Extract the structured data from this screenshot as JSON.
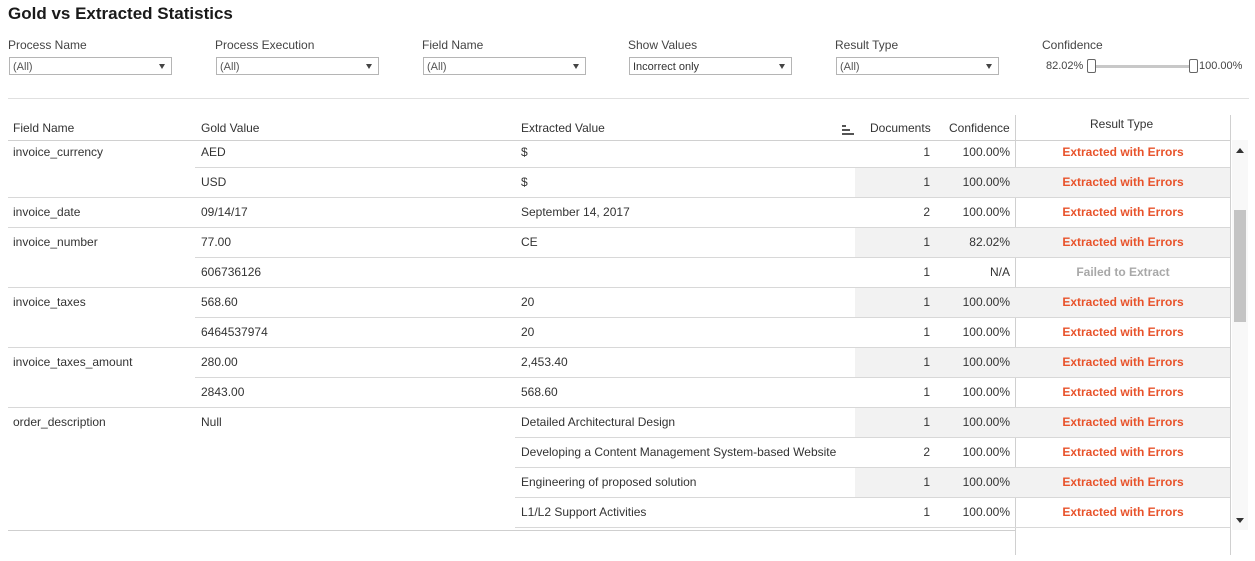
{
  "title": "Gold vs Extracted Statistics",
  "colors": {
    "error": "#e8532b",
    "failed": "#a8a8a8",
    "shade": "#f2f2f2"
  },
  "filters": [
    {
      "label": "Process Name",
      "value": "(All)"
    },
    {
      "label": "Process Execution",
      "value": "(All)"
    },
    {
      "label": "Field Name",
      "value": "(All)"
    },
    {
      "label": "Show Values",
      "value": "Incorrect only"
    },
    {
      "label": "Result Type",
      "value": "(All)"
    }
  ],
  "confidence": {
    "label": "Confidence",
    "min_label": "82.02%",
    "max_label": "100.00%",
    "range": [
      0.8202,
      1.0
    ]
  },
  "columns": {
    "field": "Field Name",
    "gold": "Gold Value",
    "extracted": "Extracted Value",
    "documents": "Documents",
    "confidence": "Confidence",
    "result": "Result Type"
  },
  "rows": [
    {
      "field": "invoice_currency",
      "gold": "AED",
      "extracted": "$",
      "documents": "1",
      "confidence": "100.00%",
      "result": "Extracted with Errors",
      "status": "error"
    },
    {
      "field": "",
      "gold": "USD",
      "extracted": "$",
      "documents": "1",
      "confidence": "100.00%",
      "result": "Extracted with Errors",
      "status": "error"
    },
    {
      "field": "invoice_date",
      "gold": "09/14/17",
      "extracted": "September 14, 2017",
      "documents": "2",
      "confidence": "100.00%",
      "result": "Extracted with Errors",
      "status": "error"
    },
    {
      "field": "invoice_number",
      "gold": "77.00",
      "extracted": "CE",
      "documents": "1",
      "confidence": "82.02%",
      "result": "Extracted with Errors",
      "status": "error"
    },
    {
      "field": "",
      "gold": "606736126",
      "extracted": "",
      "documents": "1",
      "confidence": "N/A",
      "result": "Failed to Extract",
      "status": "failed"
    },
    {
      "field": "invoice_taxes",
      "gold": "568.60",
      "extracted": "20",
      "documents": "1",
      "confidence": "100.00%",
      "result": "Extracted with Errors",
      "status": "error"
    },
    {
      "field": "",
      "gold": "6464537974",
      "extracted": "20",
      "documents": "1",
      "confidence": "100.00%",
      "result": "Extracted with Errors",
      "status": "error"
    },
    {
      "field": "invoice_taxes_amount",
      "gold": "280.00",
      "extracted": "2,453.40",
      "documents": "1",
      "confidence": "100.00%",
      "result": "Extracted with Errors",
      "status": "error"
    },
    {
      "field": "",
      "gold": "2843.00",
      "extracted": "568.60",
      "documents": "1",
      "confidence": "100.00%",
      "result": "Extracted with Errors",
      "status": "error"
    },
    {
      "field": "order_description",
      "gold": "Null",
      "extracted": "Detailed Architectural Design",
      "documents": "1",
      "confidence": "100.00%",
      "result": "Extracted with Errors",
      "status": "error"
    },
    {
      "field": "",
      "gold": "",
      "extracted": "Developing a Content Management System-based Website",
      "documents": "2",
      "confidence": "100.00%",
      "result": "Extracted with Errors",
      "status": "error"
    },
    {
      "field": "",
      "gold": "",
      "extracted": "Engineering of proposed solution",
      "documents": "1",
      "confidence": "100.00%",
      "result": "Extracted with Errors",
      "status": "error"
    },
    {
      "field": "",
      "gold": "",
      "extracted": "L1/L2 Support Activities",
      "documents": "1",
      "confidence": "100.00%",
      "result": "Extracted with Errors",
      "status": "error"
    }
  ]
}
